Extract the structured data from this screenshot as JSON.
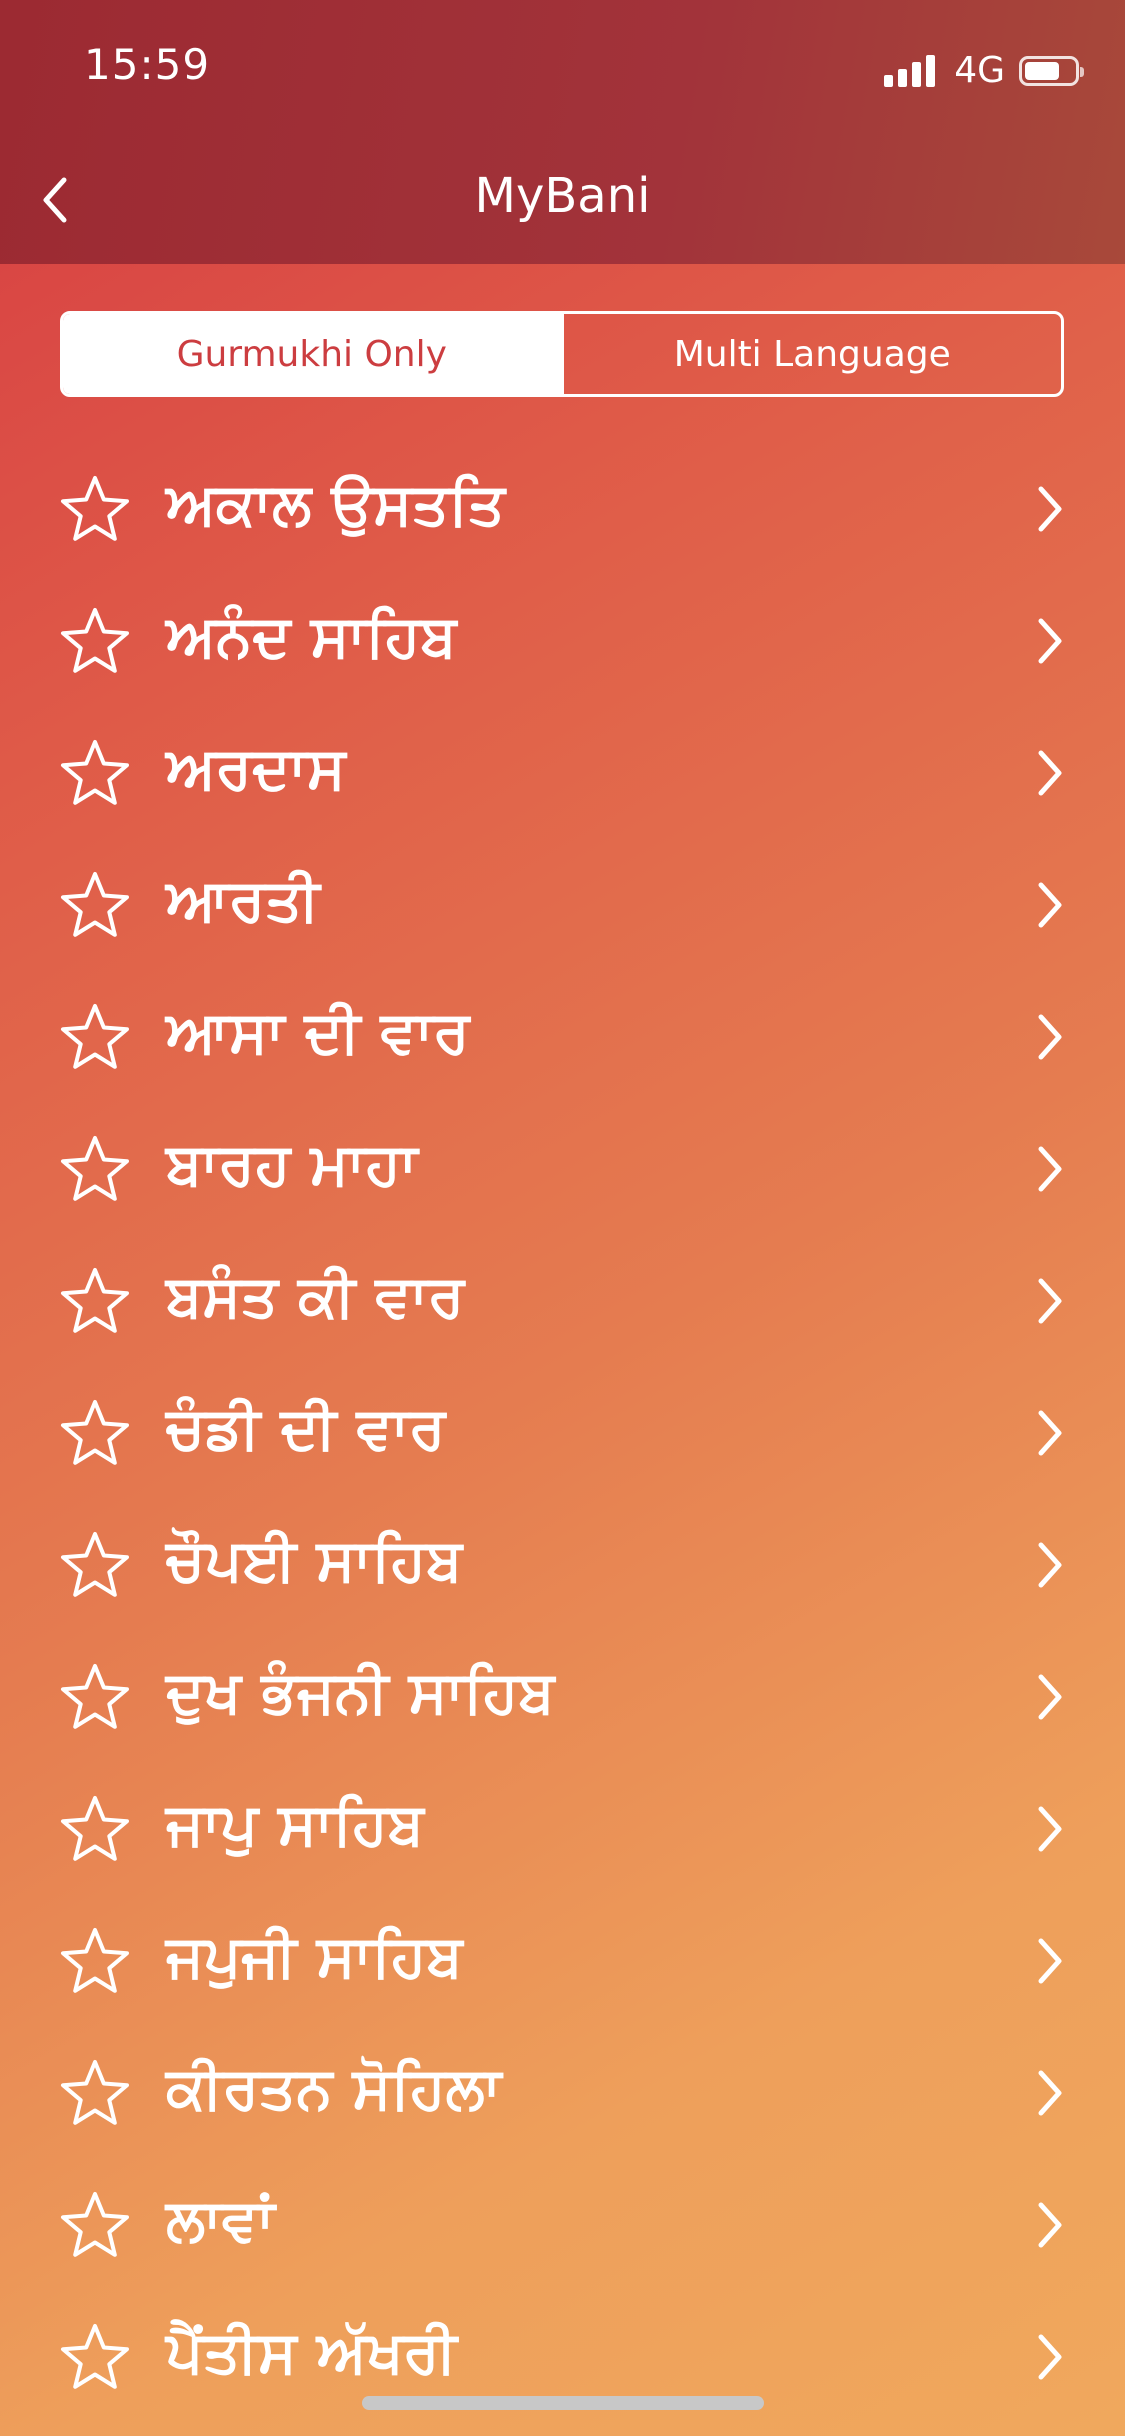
{
  "status_bar": {
    "time": "15:59",
    "network": "4G",
    "signal_bars": 4,
    "battery_level": 0.7
  },
  "nav": {
    "title": "MyBani",
    "back_icon": "chevron-left-icon"
  },
  "segmented": {
    "options": [
      "Gurmukhi Only",
      "Multi Language"
    ],
    "selected_index": 0
  },
  "items": [
    {
      "label": "ਅਕਾਲ ਉਸਤਤਿ"
    },
    {
      "label": "ਅਨੰਦ ਸਾਹਿਬ"
    },
    {
      "label": "ਅਰਦਾਸ"
    },
    {
      "label": "ਆਰਤੀ"
    },
    {
      "label": "ਆਸਾ ਦੀ ਵਾਰ"
    },
    {
      "label": "ਬਾਰਹ ਮਾਹਾ"
    },
    {
      "label": "ਬਸੰਤ ਕੀ ਵਾਰ"
    },
    {
      "label": "ਚੰਡੀ ਦੀ ਵਾਰ"
    },
    {
      "label": "ਚੌਪਈ ਸਾਹਿਬ"
    },
    {
      "label": "ਦੁਖ ਭੰਜਨੀ ਸਾਹਿਬ"
    },
    {
      "label": "ਜਾਪੁ ਸਾਹਿਬ"
    },
    {
      "label": "ਜਪੁਜੀ ਸਾਹਿਬ"
    },
    {
      "label": "ਕੀਰਤਨ ਸੋਹਿਲਾ"
    },
    {
      "label": "ਲਾਵਾਂ"
    },
    {
      "label": "ਪੈਂਤੀਸ ਅੱਖਰੀ"
    }
  ],
  "icons": {
    "favorite": "star-outline-icon",
    "disclosure": "chevron-right-icon"
  },
  "colors": {
    "header": "#9f2d34",
    "accent": "#cc3d40",
    "text": "#ffffff"
  }
}
